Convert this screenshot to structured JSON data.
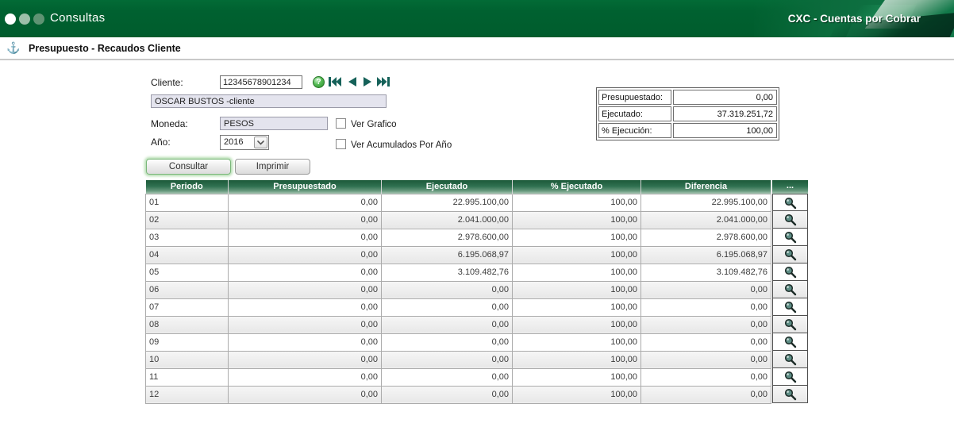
{
  "header": {
    "app_title": "Consultas",
    "brand": "CXC - Cuentas por Cobrar",
    "colors": {
      "bar_green": "#006130",
      "table_header_green": "#2f7050",
      "nav_icon_teal": "#156159"
    }
  },
  "page": {
    "title": "Presupuesto - Recaudos Cliente"
  },
  "icons": {
    "help": "?",
    "anchor": "⚓",
    "magnifier": "magnifier",
    "first": "first-record",
    "prev": "previous-record",
    "next": "next-record",
    "last": "last-record"
  },
  "form": {
    "cliente_label": "Cliente:",
    "cliente_value": "12345678901234",
    "cliente_name": "OSCAR BUSTOS -cliente",
    "moneda_label": "Moneda:",
    "moneda_value": "PESOS",
    "anio_label": "Año:",
    "anio_value": "2016",
    "ver_grafico_label": "Ver Grafico",
    "ver_acumulados_label": "Ver Acumulados Por Año",
    "consultar_label": "Consultar",
    "imprimir_label": "Imprimir"
  },
  "summary": {
    "rows": [
      {
        "label": "Presupuestado:",
        "value": "0,00"
      },
      {
        "label": "Ejecutado:",
        "value": "37.319.251,72"
      },
      {
        "label": "% Ejecución:",
        "value": "100,00"
      }
    ]
  },
  "table": {
    "headers": [
      "Periodo",
      "Presupuestado",
      "Ejecutado",
      "% Ejecutado",
      "Diferencia",
      "..."
    ],
    "rows": [
      {
        "periodo": "01",
        "presupuestado": "0,00",
        "ejecutado": "22.995.100,00",
        "pct_ejecutado": "100,00",
        "diferencia": "22.995.100,00"
      },
      {
        "periodo": "02",
        "presupuestado": "0,00",
        "ejecutado": "2.041.000,00",
        "pct_ejecutado": "100,00",
        "diferencia": "2.041.000,00"
      },
      {
        "periodo": "03",
        "presupuestado": "0,00",
        "ejecutado": "2.978.600,00",
        "pct_ejecutado": "100,00",
        "diferencia": "2.978.600,00"
      },
      {
        "periodo": "04",
        "presupuestado": "0,00",
        "ejecutado": "6.195.068,97",
        "pct_ejecutado": "100,00",
        "diferencia": "6.195.068,97"
      },
      {
        "periodo": "05",
        "presupuestado": "0,00",
        "ejecutado": "3.109.482,76",
        "pct_ejecutado": "100,00",
        "diferencia": "3.109.482,76"
      },
      {
        "periodo": "06",
        "presupuestado": "0,00",
        "ejecutado": "0,00",
        "pct_ejecutado": "100,00",
        "diferencia": "0,00"
      },
      {
        "periodo": "07",
        "presupuestado": "0,00",
        "ejecutado": "0,00",
        "pct_ejecutado": "100,00",
        "diferencia": "0,00"
      },
      {
        "periodo": "08",
        "presupuestado": "0,00",
        "ejecutado": "0,00",
        "pct_ejecutado": "100,00",
        "diferencia": "0,00"
      },
      {
        "periodo": "09",
        "presupuestado": "0,00",
        "ejecutado": "0,00",
        "pct_ejecutado": "100,00",
        "diferencia": "0,00"
      },
      {
        "periodo": "10",
        "presupuestado": "0,00",
        "ejecutado": "0,00",
        "pct_ejecutado": "100,00",
        "diferencia": "0,00"
      },
      {
        "periodo": "11",
        "presupuestado": "0,00",
        "ejecutado": "0,00",
        "pct_ejecutado": "100,00",
        "diferencia": "0,00"
      },
      {
        "periodo": "12",
        "presupuestado": "0,00",
        "ejecutado": "0,00",
        "pct_ejecutado": "100,00",
        "diferencia": "0,00"
      }
    ]
  }
}
